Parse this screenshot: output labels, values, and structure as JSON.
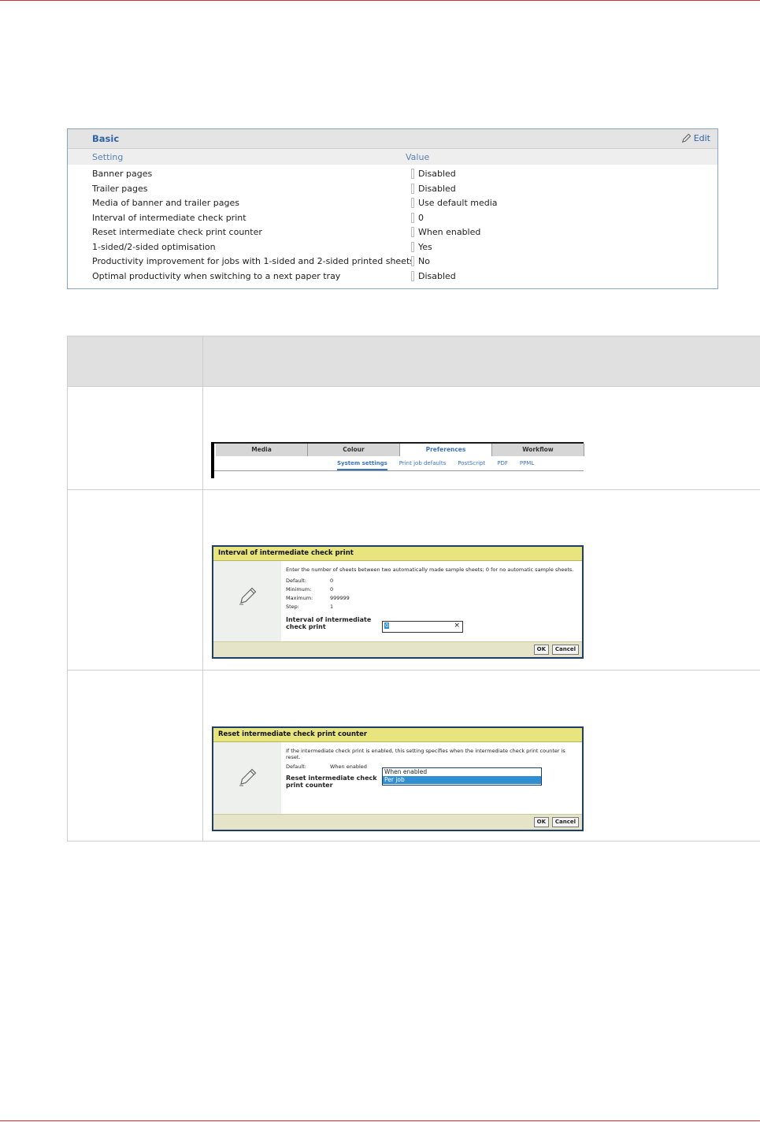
{
  "basic_panel": {
    "title": "Basic",
    "edit_label": "Edit",
    "col_setting": "Setting",
    "col_value": "Value",
    "rows": [
      {
        "setting": "Banner pages",
        "value": "Disabled"
      },
      {
        "setting": "Trailer pages",
        "value": "Disabled"
      },
      {
        "setting": "Media of banner and trailer pages",
        "value": "Use default media"
      },
      {
        "setting": "Interval of intermediate check print",
        "value": "0"
      },
      {
        "setting": "Reset intermediate check print counter",
        "value": "When enabled"
      },
      {
        "setting": "1-sided/2-sided optimisation",
        "value": "Yes"
      },
      {
        "setting": "Productivity improvement for jobs with 1-sided and 2-sided printed sheets",
        "value": "No"
      },
      {
        "setting": "Optimal productivity when switching to a next paper tray",
        "value": "Disabled"
      }
    ]
  },
  "tabshot": {
    "tabs": [
      "Media",
      "Colour",
      "Preferences",
      "Workflow"
    ],
    "subtabs": [
      "System settings",
      "Print job defaults",
      "PostScript",
      "PDF",
      "PPML"
    ]
  },
  "interval_dialog": {
    "title": "Interval of intermediate check print",
    "description": "Enter the number of sheets between two automatically made sample sheets; 0 for no automatic sample sheets.",
    "default_label": "Default:",
    "default_value": "0",
    "minimum_label": "Minimum:",
    "minimum_value": "0",
    "maximum_label": "Maximum:",
    "maximum_value": "999999",
    "step_label": "Step:",
    "step_value": "1",
    "field_label_1": "Interval of intermediate",
    "field_label_2": "check print",
    "input_value": "0",
    "clear_symbol": "×",
    "ok_label": "OK",
    "cancel_label": "Cancel"
  },
  "reset_dialog": {
    "title": "Reset intermediate check print counter",
    "description": "If the intermediate check print is enabled, this setting specifies when the intermediate check print counter is reset.",
    "default_label": "Default:",
    "default_value": "When enabled",
    "field_label_1": "Reset intermediate check",
    "field_label_2": "print counter",
    "options": [
      "When enabled",
      "Per job"
    ],
    "ok_label": "OK",
    "cancel_label": "Cancel"
  }
}
